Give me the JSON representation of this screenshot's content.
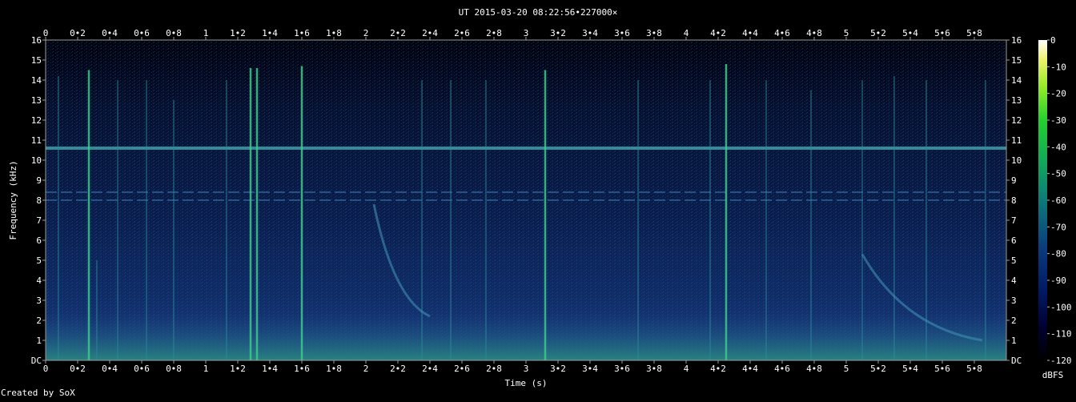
{
  "chart_data": {
    "type": "heatmap",
    "title": "UT 2015-03-20 08:22:56•227000×",
    "xlabel": "Time (s)",
    "ylabel": "Frequency (kHz)",
    "xlim": [
      0,
      6
    ],
    "ylim": [
      0,
      16
    ],
    "x_ticks": [
      "0",
      "0•2",
      "0•4",
      "0•6",
      "0•8",
      "1",
      "1•2",
      "1•4",
      "1•6",
      "1•8",
      "2",
      "2•2",
      "2•4",
      "2•6",
      "2•8",
      "3",
      "3•2",
      "3•4",
      "3•6",
      "3•8",
      "4",
      "4•2",
      "4•4",
      "4•6",
      "4•8",
      "5",
      "5•2",
      "5•4",
      "5•6",
      "5•8"
    ],
    "y_ticks": [
      "DC",
      "1",
      "2",
      "3",
      "4",
      "5",
      "6",
      "7",
      "8",
      "9",
      "10",
      "11",
      "12",
      "13",
      "14",
      "15",
      "16"
    ],
    "colorbar": {
      "label": "dBFS",
      "range": [
        -120,
        0
      ],
      "ticks": [
        "0",
        "-10",
        "-20",
        "-30",
        "-40",
        "-50",
        "-60",
        "-70",
        "-80",
        "-90",
        "-100",
        "-110",
        "-120"
      ]
    },
    "features": {
      "tone_lines_khz": [
        10.6,
        8.4,
        8.0
      ],
      "impulses": [
        {
          "t": 0.08,
          "f_top": 14.2
        },
        {
          "t": 0.27,
          "f_top": 14.5
        },
        {
          "t": 0.32,
          "f_top": 5.0
        },
        {
          "t": 0.45,
          "f_top": 14.0
        },
        {
          "t": 0.63,
          "f_top": 14.0
        },
        {
          "t": 0.8,
          "f_top": 13.0
        },
        {
          "t": 1.13,
          "f_top": 14.0
        },
        {
          "t": 1.28,
          "f_top": 14.6
        },
        {
          "t": 1.32,
          "f_top": 14.6
        },
        {
          "t": 1.6,
          "f_top": 14.7
        },
        {
          "t": 2.35,
          "f_top": 14.0
        },
        {
          "t": 2.53,
          "f_top": 14.0
        },
        {
          "t": 2.75,
          "f_top": 14.0
        },
        {
          "t": 3.12,
          "f_top": 14.5
        },
        {
          "t": 3.7,
          "f_top": 14.0
        },
        {
          "t": 4.15,
          "f_top": 14.0
        },
        {
          "t": 4.25,
          "f_top": 14.8
        },
        {
          "t": 4.5,
          "f_top": 14.0
        },
        {
          "t": 4.78,
          "f_top": 13.5
        },
        {
          "t": 5.1,
          "f_top": 14.0
        },
        {
          "t": 5.3,
          "f_top": 14.2
        },
        {
          "t": 5.5,
          "f_top": 14.0
        },
        {
          "t": 5.87,
          "f_top": 14.0
        }
      ],
      "chirps": [
        {
          "t_start": 2.05,
          "f_start_khz": 7.8,
          "t_end": 2.4,
          "f_end_khz": 2.2
        },
        {
          "t_start": 5.1,
          "f_start_khz": 5.3,
          "t_end": 5.85,
          "f_end_khz": 1.0
        }
      ]
    }
  },
  "footer": {
    "credit": "Created by SoX"
  }
}
